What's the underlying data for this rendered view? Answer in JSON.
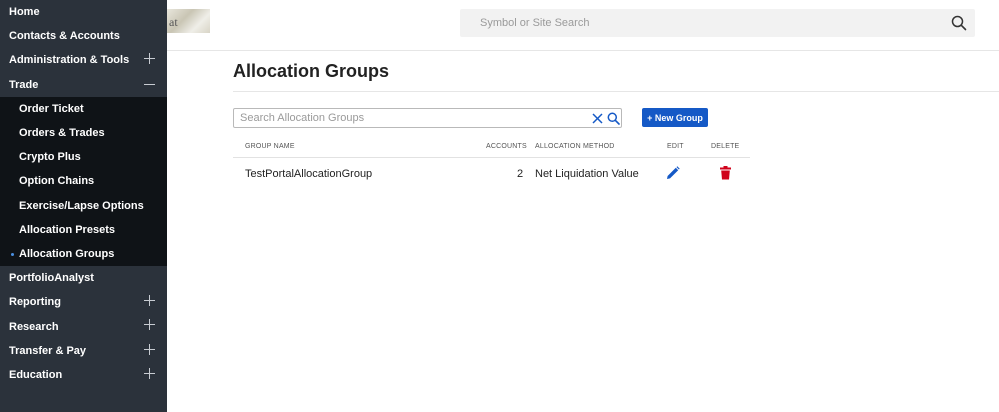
{
  "sidebar": {
    "items_top": [
      {
        "label": "Home",
        "expander": "none"
      },
      {
        "label": "Contacts & Accounts",
        "expander": "none"
      },
      {
        "label": "Administration & Tools",
        "expander": "plus"
      },
      {
        "label": "Trade",
        "expander": "minus"
      }
    ],
    "trade_submenu": [
      {
        "label": "Order Ticket"
      },
      {
        "label": "Orders & Trades"
      },
      {
        "label": "Crypto Plus"
      },
      {
        "label": "Option Chains"
      },
      {
        "label": "Exercise/Lapse Options"
      },
      {
        "label": "Allocation Presets"
      },
      {
        "label": "Allocation Groups",
        "active": true
      }
    ],
    "items_bottom": [
      {
        "label": "PortfolioAnalyst",
        "expander": "none"
      },
      {
        "label": "Reporting",
        "expander": "plus"
      },
      {
        "label": "Research",
        "expander": "plus"
      },
      {
        "label": "Transfer & Pay",
        "expander": "plus"
      },
      {
        "label": "Education",
        "expander": "plus"
      }
    ]
  },
  "logo_fragment_text": "at",
  "header": {
    "search_placeholder": "Symbol or Site Search"
  },
  "main": {
    "title": "Allocation Groups",
    "group_search_placeholder": "Search Allocation Groups",
    "new_group_label": "+ New Group",
    "columns": {
      "group_name": "GROUP NAME",
      "accounts": "ACCOUNTS",
      "allocation_method": "ALLOCATION METHOD",
      "edit": "EDIT",
      "delete": "DELETE"
    },
    "rows": [
      {
        "group_name": "TestPortalAllocationGroup",
        "accounts": "2",
        "allocation_method": "Net Liquidation Value"
      }
    ]
  },
  "colors": {
    "sidebar_bg": "#2b323b",
    "submenu_bg": "#0f1317",
    "accent_blue": "#1559c6",
    "delete_red": "#d0021b"
  }
}
